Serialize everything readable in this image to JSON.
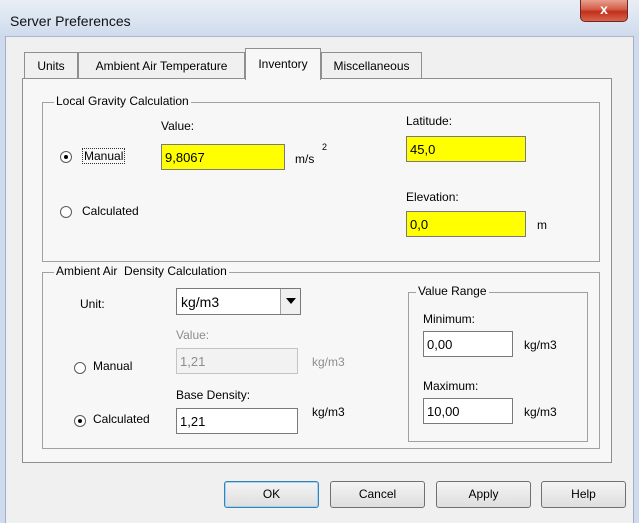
{
  "window": {
    "title": "Server Preferences",
    "close_glyph": "x"
  },
  "tabs": [
    {
      "label": "Units",
      "active": false
    },
    {
      "label": "Ambient Air Temperature",
      "active": false
    },
    {
      "label": "Inventory",
      "active": true
    },
    {
      "label": "Miscellaneous",
      "active": false
    }
  ],
  "gravity": {
    "group_label": "Local Gravity Calculation",
    "value_label": "Value:",
    "value": "9,8067",
    "unit": "m/s",
    "unit_superscript": "2",
    "manual_label": "Manual",
    "calculated_label": "Calculated",
    "selected": "manual",
    "latitude_label": "Latitude:",
    "latitude": "45,0",
    "elevation_label": "Elevation:",
    "elevation": "0,0",
    "elevation_unit": "m"
  },
  "density": {
    "group_label": "Ambient Air  Density Calculation",
    "unit_label": "Unit:",
    "unit_value": "kg/m3",
    "value_label": "Value:",
    "manual_value": "1,21",
    "manual_unit": "kg/m3",
    "manual_label": "Manual",
    "base_density_label": "Base Density:",
    "base_value": "1,21",
    "base_unit": "kg/m3",
    "calculated_label": "Calculated",
    "selected": "calculated",
    "range": {
      "group_label": "Value Range",
      "min_label": "Minimum:",
      "min_value": "0,00",
      "min_unit": "kg/m3",
      "max_label": "Maximum:",
      "max_value": "10,00",
      "max_unit": "kg/m3"
    }
  },
  "buttons": {
    "ok": "OK",
    "cancel": "Cancel",
    "apply": "Apply",
    "help": "Help"
  },
  "colors": {
    "required_field": "#ffff00",
    "dialog_bg": "#f0f0f0"
  }
}
